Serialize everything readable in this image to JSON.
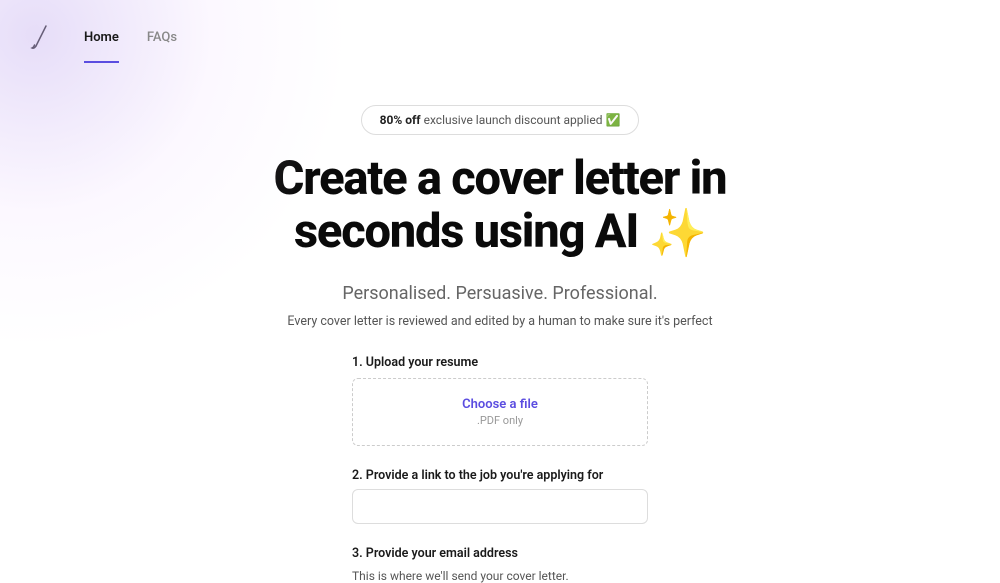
{
  "nav": {
    "home": "Home",
    "faqs": "FAQs"
  },
  "promo": {
    "bold": "80% off",
    "rest": " exclusive launch discount applied ✅"
  },
  "hero": {
    "title_line1": "Create a cover letter in",
    "title_line2": "seconds using AI ",
    "sparkle": "✨",
    "subtitle": "Personalised. Persuasive. Professional.",
    "description": "Every cover letter is reviewed and edited by a human to make sure it's perfect"
  },
  "form": {
    "step1": {
      "label": "1. Upload your resume",
      "choose": "Choose a file",
      "hint": ".PDF only"
    },
    "step2": {
      "label": "2. Provide a link to the job you're applying for"
    },
    "step3": {
      "label": "3. Provide your email address",
      "helper": "This is where we'll send your cover letter."
    }
  }
}
